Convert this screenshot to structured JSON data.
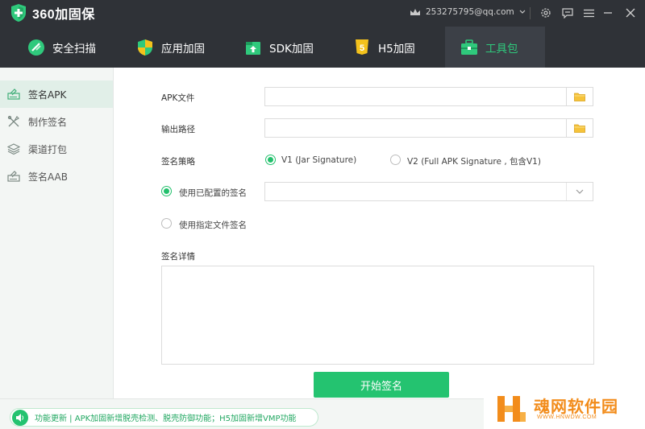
{
  "app": {
    "name": "360加固保",
    "account": "253275795@qq.com"
  },
  "tabs": [
    {
      "label": "安全扫描",
      "icon": "scan-icon"
    },
    {
      "label": "应用加固",
      "icon": "shield-icon"
    },
    {
      "label": "SDK加固",
      "icon": "sdk-icon"
    },
    {
      "label": "H5加固",
      "icon": "html5-icon"
    },
    {
      "label": "工具包",
      "icon": "toolbox-icon",
      "active": true
    }
  ],
  "sidebar": {
    "items": [
      {
        "label": "签名APK",
        "active": true
      },
      {
        "label": "制作签名"
      },
      {
        "label": "渠道打包"
      },
      {
        "label": "签名AAB"
      }
    ]
  },
  "form": {
    "apk_file_label": "APK文件",
    "apk_file_value": "",
    "output_path_label": "输出路径",
    "output_path_value": "",
    "strategy_label": "签名策略",
    "v1_label": "V1 (Jar Signature)",
    "v2_label": "V2 (Full APK Signature , 包含V1)",
    "v1_selected": true,
    "use_configured_label": "使用已配置的签名",
    "use_configured_selected": true,
    "configured_value": "",
    "use_file_label": "使用指定文件签名",
    "details_label": "签名详情",
    "details_value": "",
    "start_button": "开始签名"
  },
  "footer": {
    "notice": "功能更新 | APK加固新增脱壳检测、脱壳防御功能；H5加固新增VMP功能"
  },
  "watermark": {
    "title": "魂网软件园",
    "url": "WWW.HNWDW.COM"
  },
  "colors": {
    "accent": "#24c370",
    "titlebar": "#2f3237",
    "watermark": "#f28c1b"
  }
}
